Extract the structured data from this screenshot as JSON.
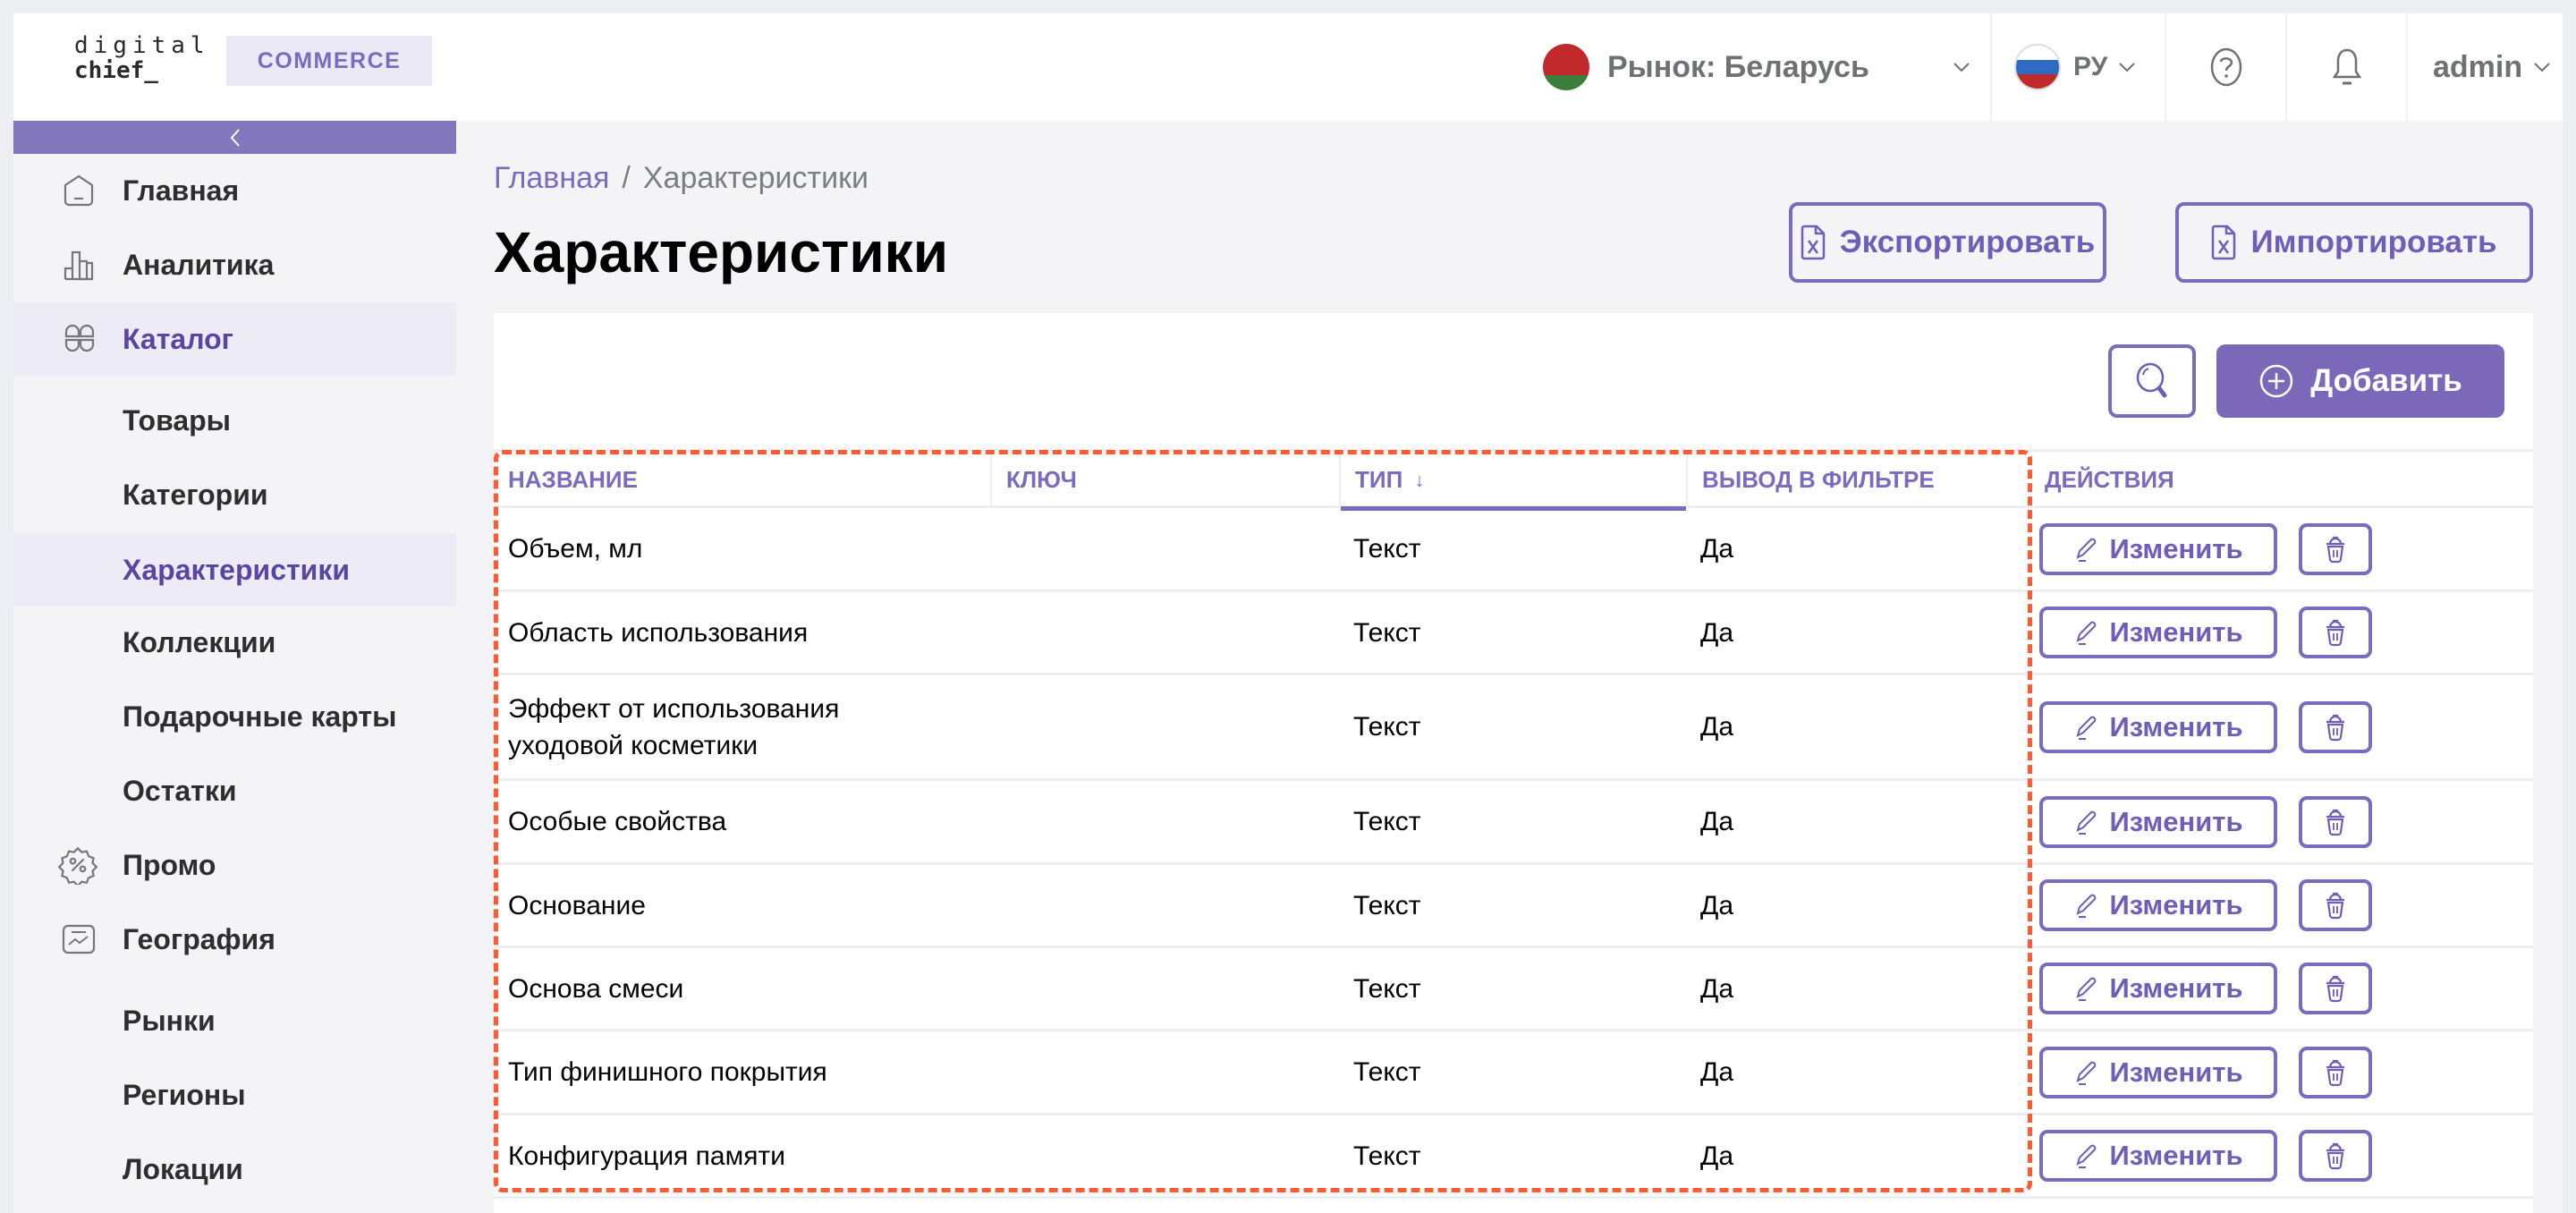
{
  "header": {
    "logo_line1": "digital",
    "logo_line2": "chief_",
    "product_badge": "COMMERCE",
    "market_label": "Рынок: Беларусь",
    "language_label": "РУ",
    "user_label": "admin",
    "icons": {
      "market_flag": "belarus-flag-icon",
      "language_flag": "russia-flag-icon",
      "help": "question-circle-icon",
      "notifications": "bell-icon",
      "dropdown": "chevron-down-icon"
    }
  },
  "sidebar": {
    "collapse_icon": "chevron-left-icon",
    "items": [
      {
        "label": "Главная",
        "icon": "home-icon",
        "level": 1,
        "active": false
      },
      {
        "label": "Аналитика",
        "icon": "bar-chart-icon",
        "level": 1,
        "active": false
      },
      {
        "label": "Каталог",
        "icon": "grid-icon",
        "level": 1,
        "active": true
      },
      {
        "label": "Товары",
        "level": 2,
        "active": false
      },
      {
        "label": "Категории",
        "level": 2,
        "active": false
      },
      {
        "label": "Характеристики",
        "level": 2,
        "active": true
      },
      {
        "label": "Коллекции",
        "level": 2,
        "active": false
      },
      {
        "label": "Подарочные карты",
        "level": 2,
        "active": false
      },
      {
        "label": "Остатки",
        "level": 2,
        "active": false
      },
      {
        "label": "Промо",
        "icon": "discount-badge-icon",
        "level": 1,
        "active": false
      },
      {
        "label": "География",
        "icon": "chart-card-icon",
        "level": 1,
        "active": false
      },
      {
        "label": "Рынки",
        "level": 2,
        "active": false
      },
      {
        "label": "Регионы",
        "level": 2,
        "active": false
      },
      {
        "label": "Локации",
        "level": 2,
        "active": false
      }
    ]
  },
  "breadcrumb": {
    "home": "Главная",
    "separator": "/",
    "current": "Характеристики"
  },
  "page": {
    "title": "Характеристики",
    "export_label": "Экспортировать",
    "import_label": "Импортировать",
    "add_label": "Добавить"
  },
  "table": {
    "columns": {
      "name": "НАЗВАНИЕ",
      "key": "КЛЮЧ",
      "type": "ТИП",
      "type_sort": "↓",
      "filter": "ВЫВОД В ФИЛЬТРЕ",
      "actions": "ДЕЙСТВИЯ"
    },
    "edit_label": "Изменить",
    "rows": [
      {
        "name": "Объем, мл",
        "key": "",
        "type": "Текст",
        "filter": "Да"
      },
      {
        "name": "Область использования",
        "key": "",
        "type": "Текст",
        "filter": "Да"
      },
      {
        "name": "Эффект от использования уходовой косметики",
        "key": "",
        "type": "Текст",
        "filter": "Да"
      },
      {
        "name": "Особые свойства",
        "key": "",
        "type": "Текст",
        "filter": "Да"
      },
      {
        "name": "Основание",
        "key": "",
        "type": "Текст",
        "filter": "Да"
      },
      {
        "name": "Основа смеси",
        "key": "",
        "type": "Текст",
        "filter": "Да"
      },
      {
        "name": "Тип финишного покрытия",
        "key": "",
        "type": "Текст",
        "filter": "Да"
      },
      {
        "name": "Конфигурация памяти",
        "key": "",
        "type": "Текст",
        "filter": "Да"
      }
    ]
  },
  "colors": {
    "accent": "#7b6bbf",
    "accent_button": "#7b68b9",
    "collapse_bar": "#8276bd",
    "active_nav_bg": "#ecebf6",
    "highlight_dashed": "#ff5a33"
  }
}
